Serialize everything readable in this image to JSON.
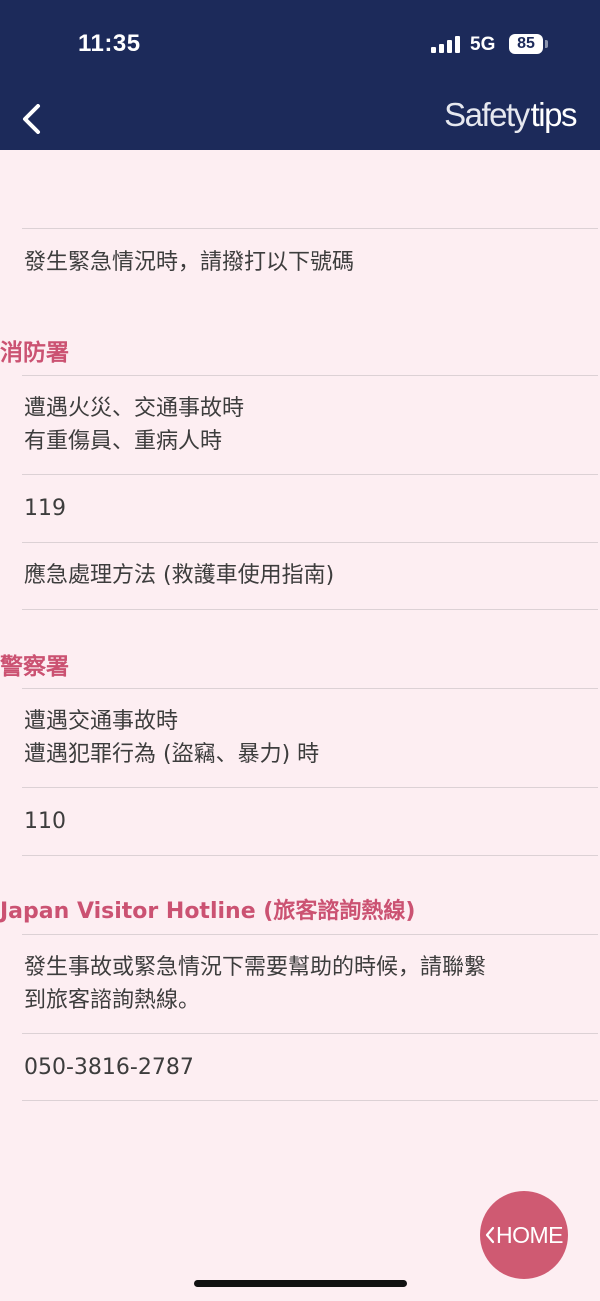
{
  "status_bar": {
    "time": "11:35",
    "network": "5G",
    "battery": "85"
  },
  "header": {
    "title_part1": "Safety",
    "title_part2": "tips"
  },
  "intro": "發生緊急情況時，請撥打以下號碼",
  "sections": [
    {
      "title": "消防署",
      "situations": [
        "遭遇火災、交通事故時",
        "有重傷員、重病人時"
      ],
      "number": "119",
      "link": "應急處理方法 (救護車使用指南)"
    },
    {
      "title": "警察署",
      "situations": [
        "遭遇交通事故時",
        "遭遇犯罪行為 (盜竊、暴力) 時"
      ],
      "number": "110"
    },
    {
      "title": "Japan Visitor Hotline (旅客諮詢熱線)",
      "situations": [
        "發生事故或緊急情況下需要幫助的時候，請聯繫",
        "到旅客諮詢熱線。"
      ],
      "number": "050-3816-2787"
    }
  ],
  "home_button": "HOME",
  "colors": {
    "header_bg": "#1c2a5a",
    "page_bg": "#fdeef2",
    "accent": "#cb5272",
    "home_button_bg": "#cf5a72"
  }
}
